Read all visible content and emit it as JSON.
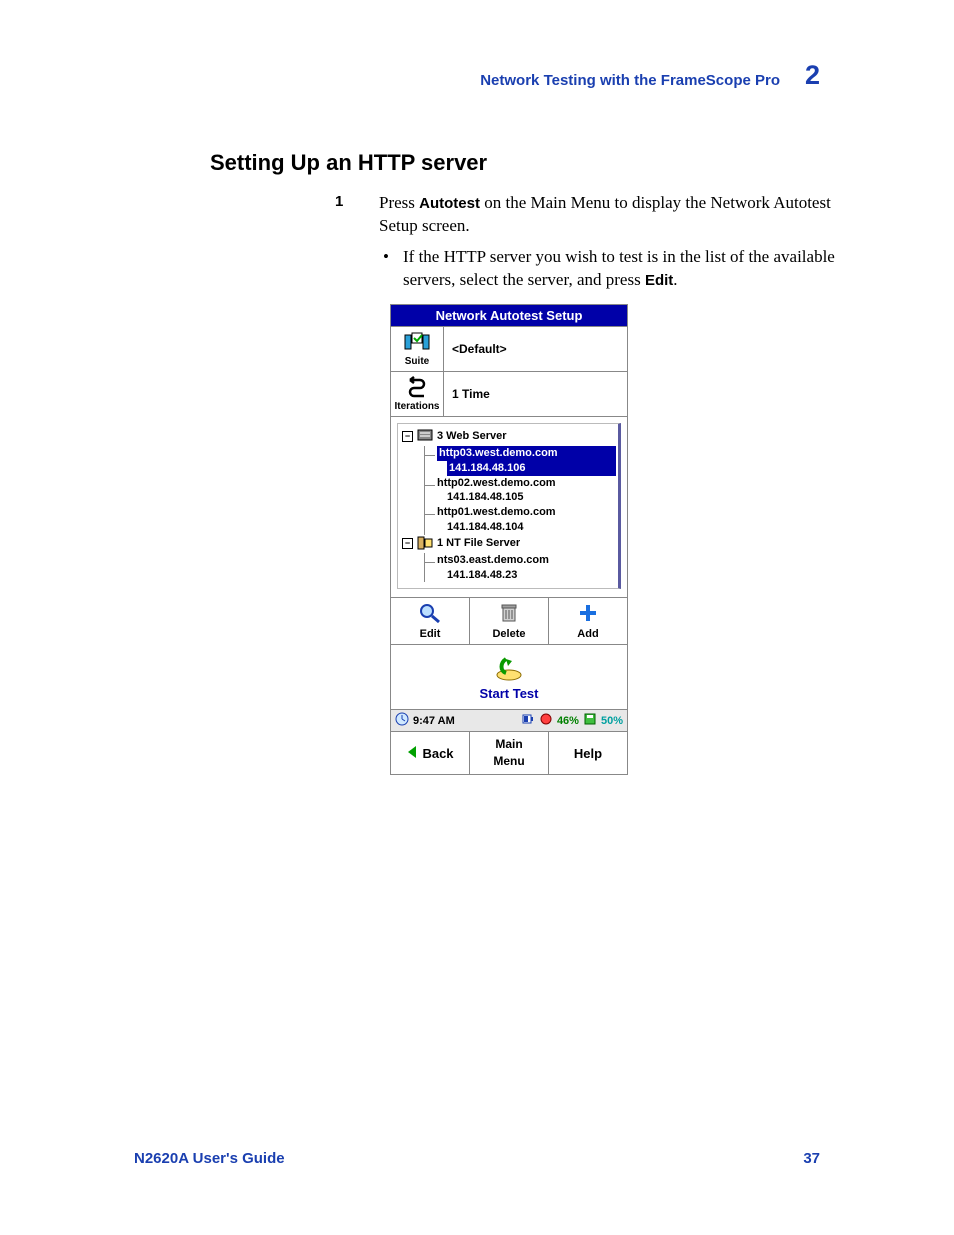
{
  "header": {
    "section": "Network Testing with the FrameScope Pro",
    "chapter": "2"
  },
  "title": "Setting Up an HTTP server",
  "step": {
    "num": "1",
    "text_pre": "Press ",
    "text_bold1": "Autotest",
    "text_mid": " on the Main Menu to display the Network Autotest Setup screen.",
    "bullet_pre": "If the HTTP server you wish to test is in the list of the available servers, select the server, and press ",
    "bullet_bold": "Edit",
    "bullet_post": "."
  },
  "device": {
    "title": "Network Autotest Setup",
    "suite": {
      "label": "Suite",
      "value": "<Default>"
    },
    "iterations": {
      "label": "Iterations",
      "value": "1 Time"
    },
    "tree": {
      "group1": {
        "count_label": "3 Web Server"
      },
      "leaves1": [
        {
          "name": "http03.west.demo.com",
          "ip": "141.184.48.106",
          "selected": true
        },
        {
          "name": "http02.west.demo.com",
          "ip": "141.184.48.105",
          "selected": false
        },
        {
          "name": "http01.west.demo.com",
          "ip": "141.184.48.104",
          "selected": false
        }
      ],
      "group2": {
        "count_label": "1 NT File Server"
      },
      "leaves2": [
        {
          "name": "nts03.east.demo.com",
          "ip": "141.184.48.23",
          "selected": false
        }
      ]
    },
    "actions": {
      "edit": "Edit",
      "delete": "Delete",
      "add": "Add"
    },
    "start": "Start Test",
    "status": {
      "time": "9:47 AM",
      "pct1": "46%",
      "pct2": "50%"
    },
    "nav": {
      "back": "Back",
      "main1": "Main",
      "main2": "Menu",
      "help": "Help"
    }
  },
  "footer": {
    "left": "N2620A User's Guide",
    "right": "37"
  }
}
